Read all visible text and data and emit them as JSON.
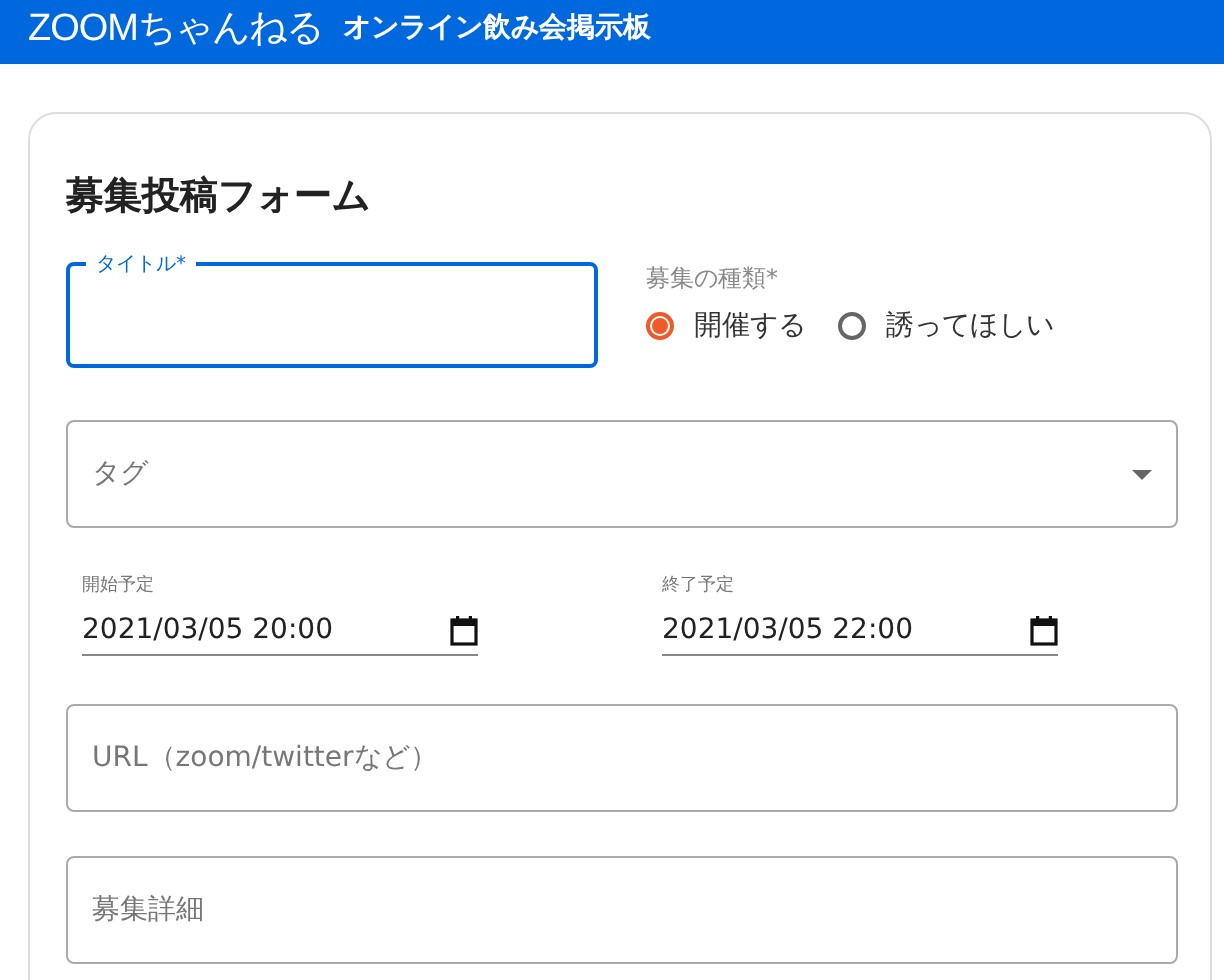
{
  "header": {
    "logo": "ZOOMちゃんねる",
    "subtitle": "オンライン飲み会掲示板"
  },
  "form": {
    "title": "募集投稿フォーム",
    "title_field": {
      "label": "タイトル*",
      "focused": true
    },
    "type_group": {
      "label": "募集の種類*",
      "options": [
        {
          "label": "開催する",
          "selected": true
        },
        {
          "label": "誘ってほしい",
          "selected": false
        }
      ]
    },
    "tag_select": {
      "placeholder": "タグ"
    },
    "dates": [
      {
        "label": "開始予定",
        "value": "2021/03/05 20:00"
      },
      {
        "label": "終了予定",
        "value": "2021/03/05 22:00"
      }
    ],
    "url_field": {
      "placeholder": "URL（zoom/twitterなど）"
    },
    "details_field": {
      "placeholder": "募集詳細"
    }
  }
}
